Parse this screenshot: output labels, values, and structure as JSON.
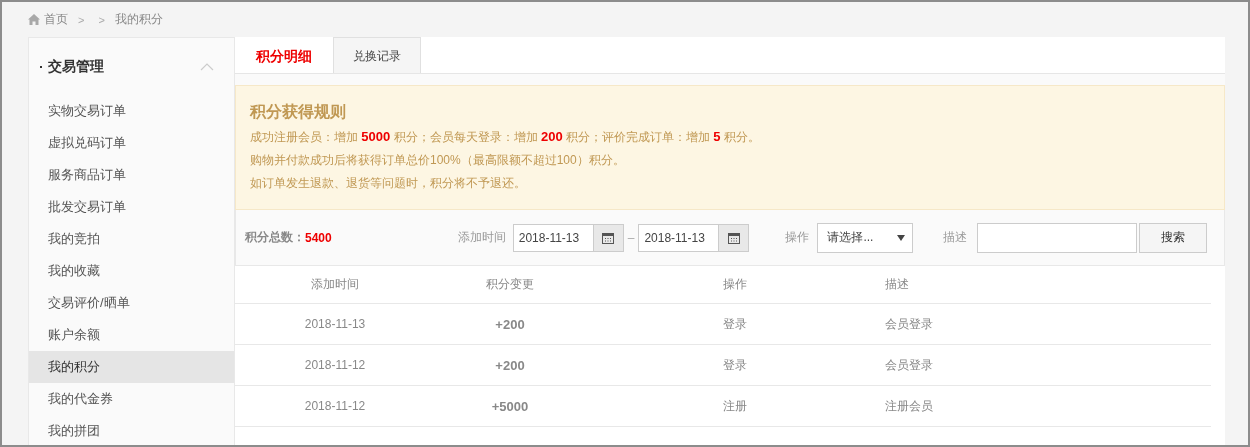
{
  "breadcrumb": {
    "items": [
      "首页",
      "我的积分"
    ],
    "separators": [
      ">",
      ">"
    ]
  },
  "sidebar": {
    "title": "交易管理",
    "expanded": true,
    "items": [
      {
        "label": "实物交易订单",
        "selected": false
      },
      {
        "label": "虚拟兑码订单",
        "selected": false
      },
      {
        "label": "服务商品订单",
        "selected": false
      },
      {
        "label": "批发交易订单",
        "selected": false
      },
      {
        "label": "我的竞拍",
        "selected": false
      },
      {
        "label": "我的收藏",
        "selected": false
      },
      {
        "label": "交易评价/晒单",
        "selected": false
      },
      {
        "label": "账户余额",
        "selected": false
      },
      {
        "label": "我的积分",
        "selected": true
      },
      {
        "label": "我的代金券",
        "selected": false
      },
      {
        "label": "我的拼团",
        "selected": false
      }
    ]
  },
  "tabs": [
    {
      "label": "积分明细",
      "selected": true
    },
    {
      "label": "兑换记录",
      "selected": false
    }
  ],
  "rules": {
    "title": "积分获得规则",
    "lines": [
      "成功注册会员：增加 **5000** 积分；会员每天登录：增加 **200** 积分；评价完成订单：增加 **5** 积分。",
      "购物并付款成功后将获得订单总价100%（最高限额不超过100）积分。",
      "如订单发生退款、退货等问题时，积分将不予退还。"
    ]
  },
  "filter": {
    "total_label": "积分总数：",
    "total_value": "5400",
    "date_label": "添加时间",
    "date_from": "2018-11-13",
    "date_separator": "–",
    "date_to": "2018-11-13",
    "action_label": "操作",
    "action_select": "请选择...",
    "description_label": "描述",
    "search_button": "搜索"
  },
  "table": {
    "columns": [
      "添加时间",
      "积分变更",
      "操作",
      "描述"
    ],
    "rows": [
      [
        "2018-11-13",
        "+200",
        "登录",
        "会员登录"
      ],
      [
        "2018-11-12",
        "+200",
        "登录",
        "会员登录"
      ],
      [
        "2018-11-12",
        "+5000",
        "注册",
        "注册会员"
      ]
    ]
  }
}
